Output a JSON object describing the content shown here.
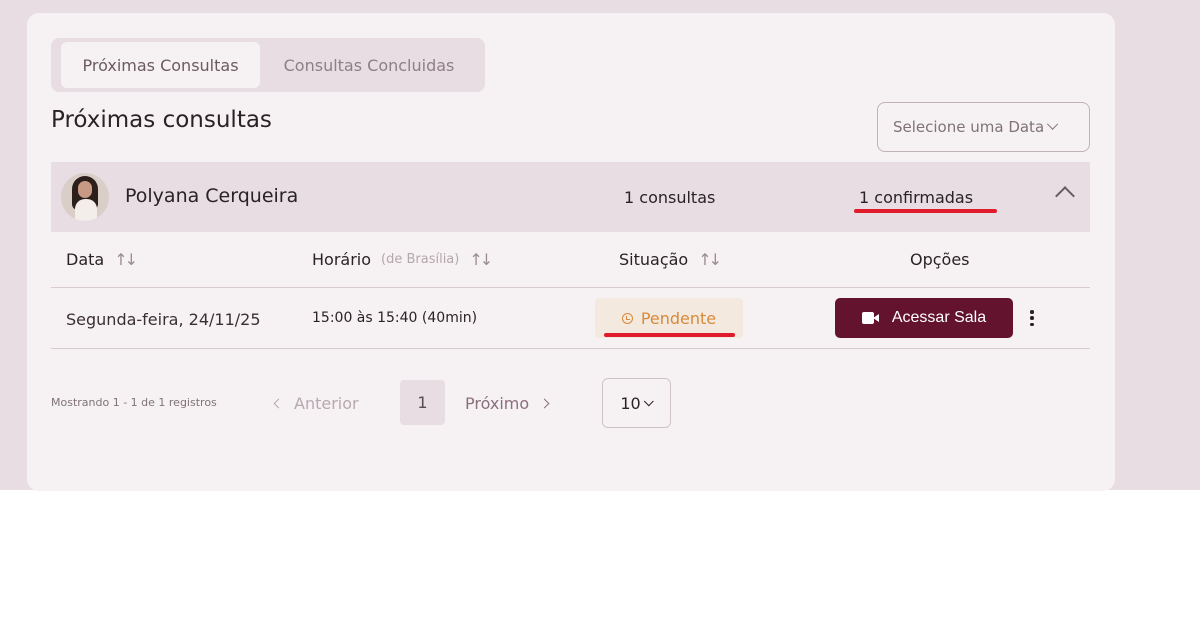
{
  "tabs": [
    {
      "label": "Próximas Consultas",
      "active": true
    },
    {
      "label": "Consultas Concluidas",
      "active": false
    }
  ],
  "page_title": "Próximas consultas",
  "date_filter": {
    "placeholder": "Selecione uma Data"
  },
  "patient": {
    "name": "Polyana Cerqueira",
    "consult_count": "1 consultas",
    "confirmed_count": "1 confirmadas"
  },
  "table": {
    "headers": {
      "date": "Data",
      "time": "Horário",
      "time_sub": "(de Brasília)",
      "status": "Situação",
      "options": "Opções"
    },
    "rows": [
      {
        "date": "Segunda-feira, 24/11/25",
        "time": "15:00 às 15:40 (40min)",
        "status": "Pendente",
        "action": "Acessar Sala"
      }
    ]
  },
  "pagination": {
    "showing": "Mostrando 1 - 1 de 1 registros",
    "prev_label": "Anterior",
    "current_page": "1",
    "next_label": "Próximo",
    "per_page": "10"
  },
  "colors": {
    "accent": "#63132e",
    "status_pending": "#d78a3a",
    "annotation_red": "#e01b2b"
  },
  "icons": {
    "sort": "sort-arrows-icon",
    "collapse": "chevron-up-icon",
    "camera": "video-camera-icon",
    "more": "more-vertical-icon",
    "status": "clock-icon"
  }
}
